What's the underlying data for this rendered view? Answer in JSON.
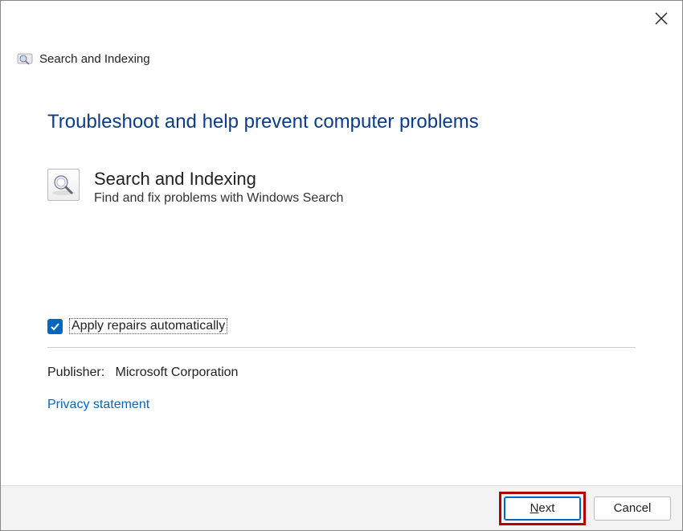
{
  "window": {
    "header_title": "Search and Indexing"
  },
  "content": {
    "main_heading": "Troubleshoot and help prevent computer problems",
    "module": {
      "title": "Search and Indexing",
      "description": "Find and fix problems with Windows Search"
    },
    "checkbox": {
      "label": "Apply repairs automatically",
      "checked": true
    },
    "publisher": {
      "label": "Publisher:",
      "value": "Microsoft Corporation"
    },
    "privacy_link": "Privacy statement"
  },
  "footer": {
    "next_label": "Next",
    "cancel_label": "Cancel"
  }
}
